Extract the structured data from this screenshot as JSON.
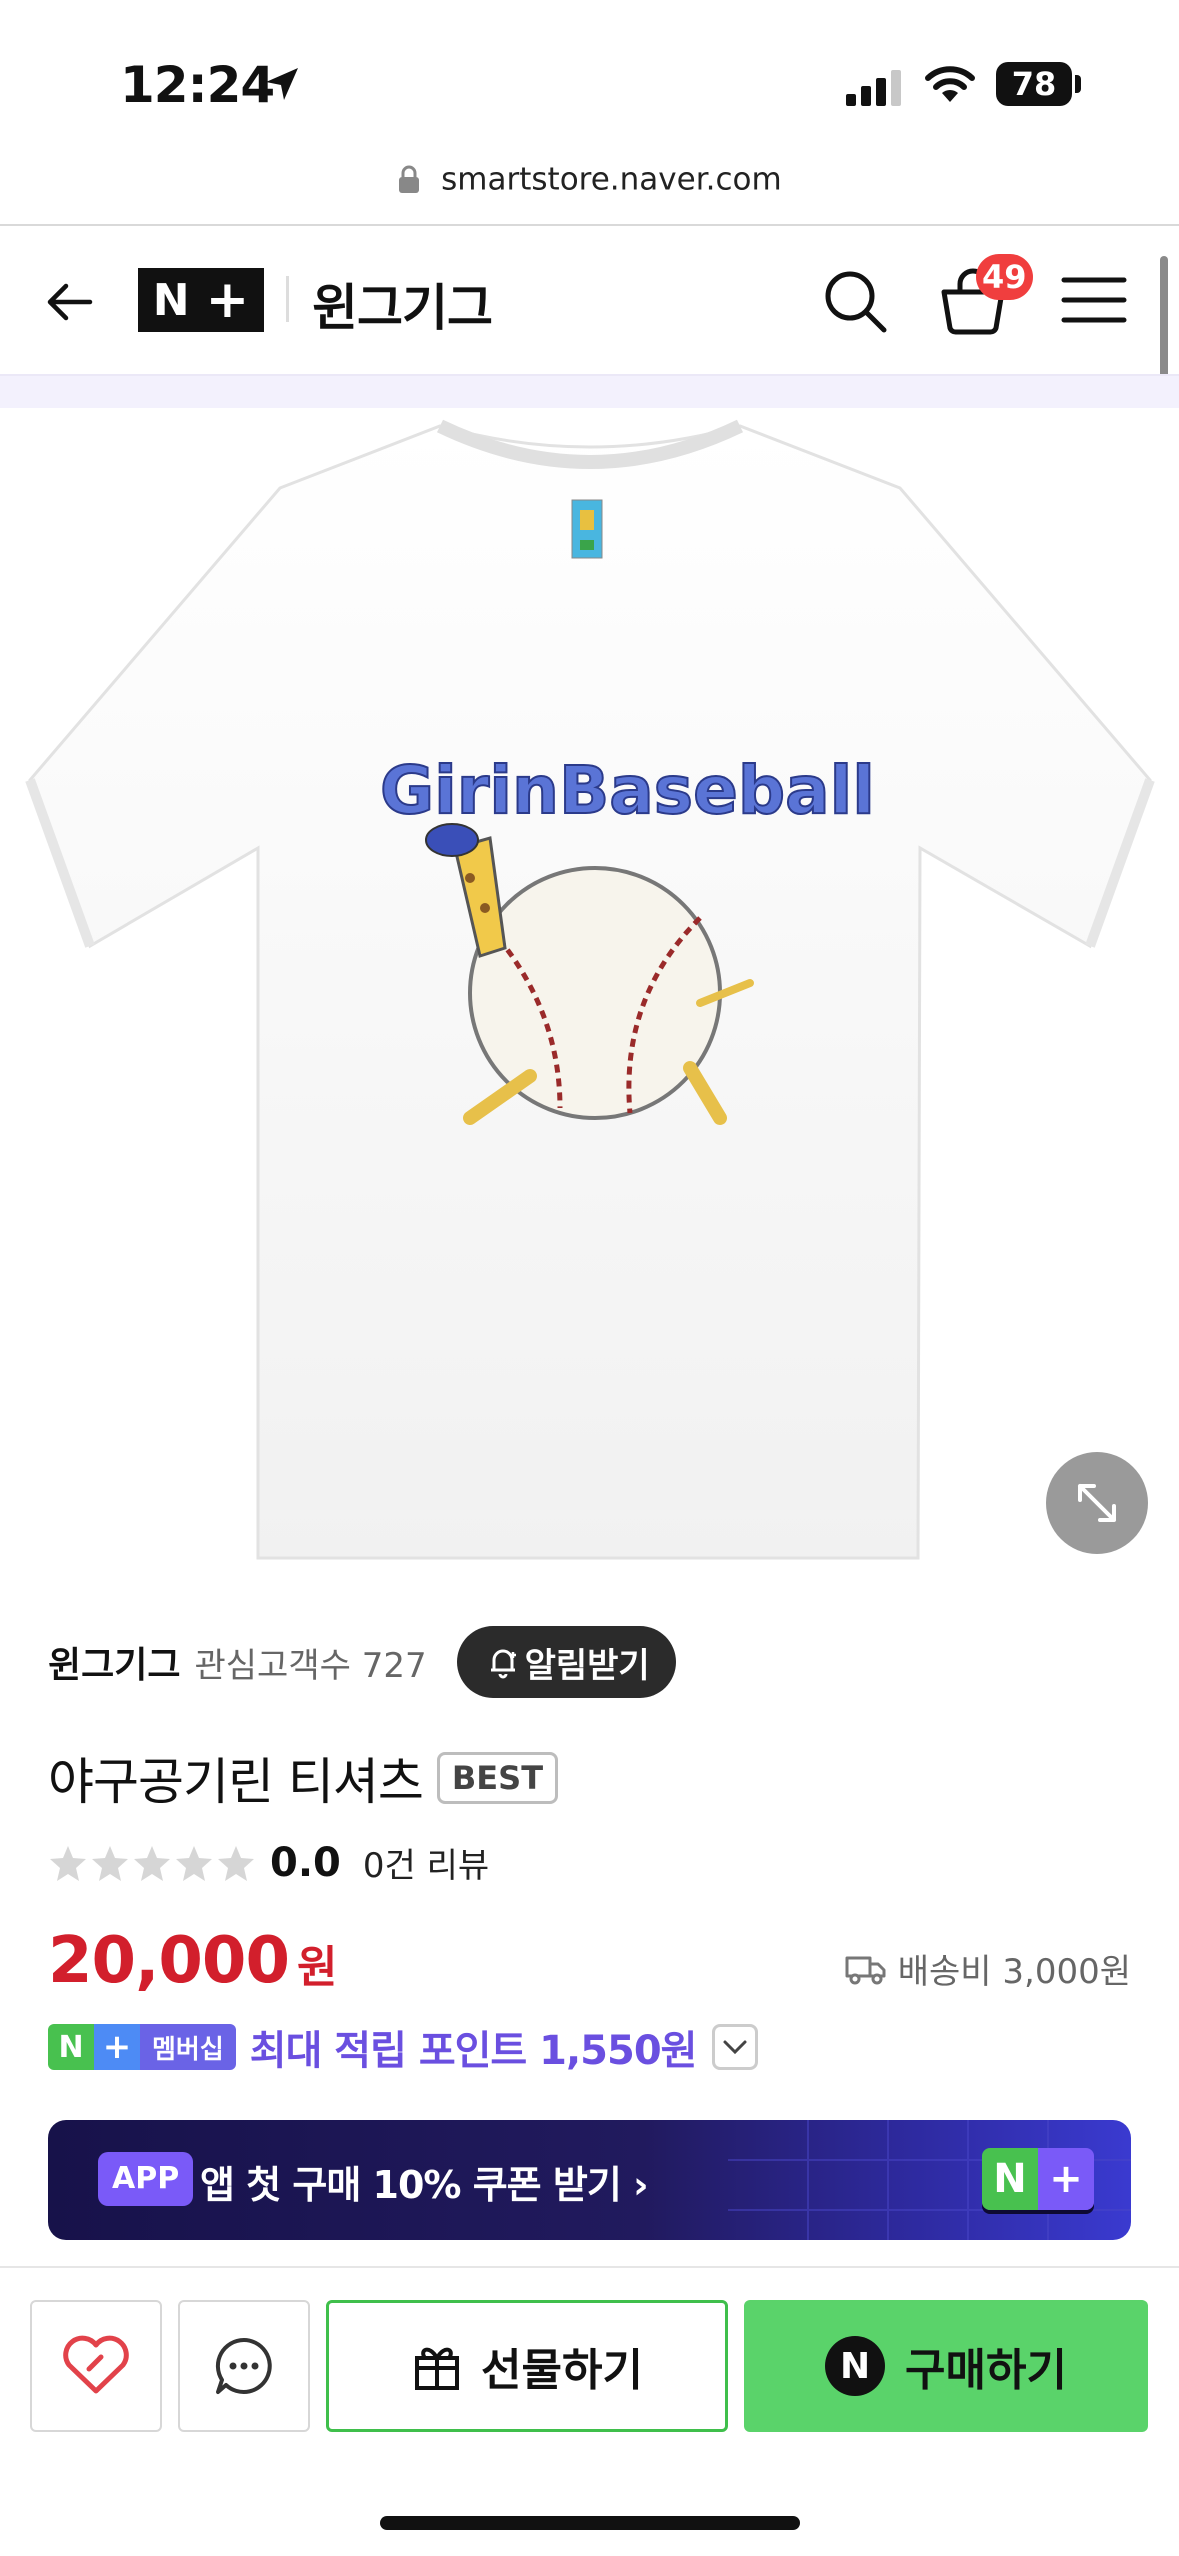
{
  "status_bar": {
    "time": "12:24",
    "battery": "78"
  },
  "browser": {
    "url": "smartstore.naver.com"
  },
  "header": {
    "logo_letter": "N",
    "logo_plus": "+",
    "store_name": "윈그기그",
    "cart_count": "49"
  },
  "product_image": {
    "shirt_text": "GirinBaseball",
    "icon": "tshirt-illustration"
  },
  "store_info": {
    "name": "윈그기그",
    "interest_label": "관심고객수 727",
    "alert_button": "알림받기"
  },
  "product": {
    "title": "야구공기린 티셔츠",
    "badge": "BEST",
    "rating_stars": 0,
    "rating_score": "0.0",
    "review_count": "0건 리뷰",
    "price": "20,000",
    "currency": "원",
    "shipping": "배송비 3,000원"
  },
  "membership": {
    "badge_n": "N",
    "badge_plus": "+",
    "badge_label": "멤버십",
    "points_text": "최대 적립 포인트 1,550원"
  },
  "app_banner": {
    "pill": "APP",
    "text": "앱 첫 구매 10% 쿠폰 받기 ›",
    "np_n": "N",
    "np_plus": "+"
  },
  "bottom_bar": {
    "gift_label": "선물하기",
    "buy_label": "구매하기",
    "buy_circle": "N"
  },
  "colors": {
    "price": "#d21f2c",
    "buy_green": "#5ad36a",
    "points_purple": "#6a4fe0",
    "badge_red": "#f03e3e"
  }
}
